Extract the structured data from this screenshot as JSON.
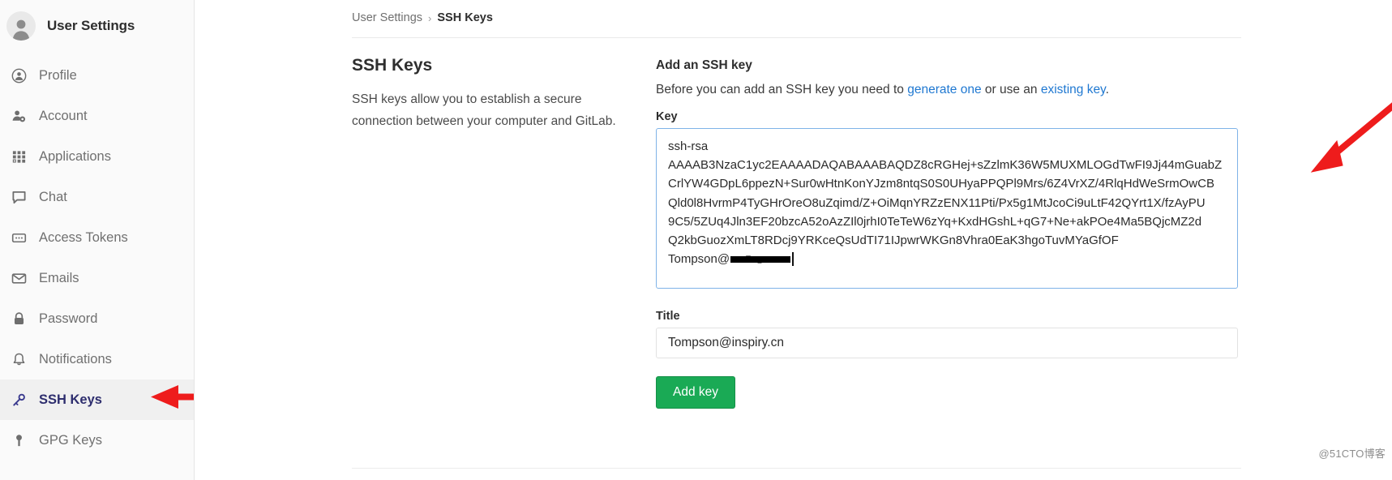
{
  "sidebar": {
    "title": "User Settings",
    "avatar_icon": "user-avatar-icon",
    "items": [
      {
        "label": "Profile",
        "icon": "user-circle-icon",
        "active": false
      },
      {
        "label": "Account",
        "icon": "user-gear-icon",
        "active": false
      },
      {
        "label": "Applications",
        "icon": "grid-apps-icon",
        "active": false
      },
      {
        "label": "Chat",
        "icon": "chat-bubble-icon",
        "active": false
      },
      {
        "label": "Access Tokens",
        "icon": "token-card-icon",
        "active": false
      },
      {
        "label": "Emails",
        "icon": "envelope-icon",
        "active": false
      },
      {
        "label": "Password",
        "icon": "lock-icon",
        "active": false
      },
      {
        "label": "Notifications",
        "icon": "bell-icon",
        "active": false
      },
      {
        "label": "SSH Keys",
        "icon": "key-icon",
        "active": true
      },
      {
        "label": "GPG Keys",
        "icon": "key-round-icon",
        "active": false
      }
    ]
  },
  "breadcrumb": {
    "parent": "User Settings",
    "separator": "›",
    "current": "SSH Keys"
  },
  "left_column": {
    "heading": "SSH Keys",
    "description": "SSH keys allow you to establish a secure connection between your computer and GitLab."
  },
  "form": {
    "heading": "Add an SSH key",
    "intro_prefix": "Before you can add an SSH key you need to ",
    "intro_link1": "generate one",
    "intro_middle": " or use an ",
    "intro_link2": "existing key",
    "intro_suffix": ".",
    "key_label": "Key",
    "key_lines": [
      "ssh-rsa",
      "AAAAB3NzaC1yc2EAAAADAQABAAABAQDZ8cRGHej+sZzlmK36W5MUXMLOGdTwFI9Jj44mGuabZ",
      "CrlYW4GDpL6ppezN+Sur0wHtnKonYJzm8ntqS0S0UHyaPPQPl9Mrs/6Z4VrXZ/4RlqHdWeSrmOwCB",
      "Qld0l8HvrmP4TyGHrOreO8uZqimd/Z+OiMqnYRZzENX11Pti/Px5g1MtJcoCi9uLtF42QYrt1X/fzAyPU",
      "9C5/5ZUq4Jln3EF20bzcA52oAzZIl0jrhI0TeTeW6zYq+KxdHGshL+qG7+Ne+akPOe4Ma5BQjcMZ2d",
      "Q2kbGuozXmLT8RDcj9YRKceQsUdTI71IJpwrWKGn8Vhra0EaK3hgoTuvMYaGfOF"
    ],
    "key_last_prefix": "Tompson@",
    "key_last_redacted": true,
    "title_label": "Title",
    "title_value": "Tompson@inspiry.cn",
    "submit_label": "Add key"
  },
  "watermark": "@51CTO博客",
  "colors": {
    "accent_green": "#1aaa55",
    "link_blue": "#1f78d1",
    "focus_border": "#7fb3e8",
    "active_item_bg": "#f0f0f0",
    "active_item_text": "#2e2e6e",
    "annotation_red": "#ee1c1c"
  }
}
